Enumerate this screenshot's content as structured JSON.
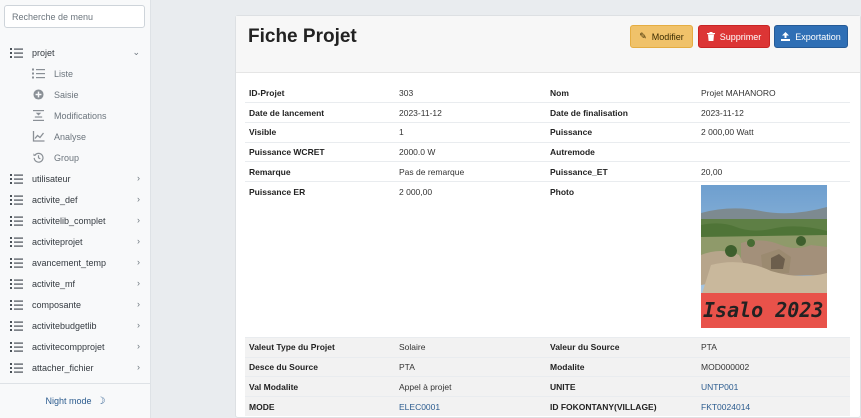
{
  "search": {
    "placeholder": "Recherche de menu"
  },
  "sidebar": {
    "open_item": {
      "label": "projet",
      "chevron": "chevron-down-icon"
    },
    "sub_items": [
      {
        "label": "Liste",
        "icon": "list-icon"
      },
      {
        "label": "Saisie",
        "icon": "plus-circle-icon"
      },
      {
        "label": "Modifications",
        "icon": "compress-icon"
      },
      {
        "label": "Analyse",
        "icon": "chart-line-icon"
      },
      {
        "label": "Group",
        "icon": "history-icon"
      }
    ],
    "items": [
      {
        "label": "utilisateur"
      },
      {
        "label": "activite_def"
      },
      {
        "label": "activitelib_complet"
      },
      {
        "label": "activiteprojet"
      },
      {
        "label": "avancement_temp"
      },
      {
        "label": "activite_mf"
      },
      {
        "label": "composante"
      },
      {
        "label": "activitebudgetlib"
      },
      {
        "label": "activitecompprojet"
      },
      {
        "label": "attacher_fichier"
      }
    ],
    "night_mode": "Night mode"
  },
  "main": {
    "title": "Fiche Projet",
    "buttons": {
      "edit": "Modifier",
      "delete": "Supprimer",
      "export": "Exportation"
    },
    "photo_caption": "Isalo 2023",
    "rows": [
      {
        "k1": "ID-Projet",
        "v1": "303",
        "k2": "Nom",
        "v2": "Projet MAHANORO"
      },
      {
        "k1": "Date de lancement",
        "v1": "2023-11-12",
        "k2": "Date de finalisation",
        "v2": "2023-11-12"
      },
      {
        "k1": "Visible",
        "v1": "1",
        "k2": "Puissance",
        "v2": "2 000,00 Watt"
      },
      {
        "k1": "Puissance WCRET",
        "v1": "2000.0 W",
        "k2": "Autremode",
        "v2": ""
      },
      {
        "k1": "Remarque",
        "v1": "Pas de remarque",
        "k2": "Puissance_ET",
        "v2": "20,00"
      },
      {
        "k1": "Puissance ER",
        "v1": "2 000,00",
        "k2": "Photo",
        "v2": ""
      },
      {
        "k1": "Valeut Type du Projet",
        "v1": "Solaire",
        "k2": "Valeur du Source",
        "v2": "PTA"
      },
      {
        "k1": "Desce du Source",
        "v1": "PTA",
        "k2": "Modalite",
        "v2": "MOD000002"
      },
      {
        "k1": "Val Modalite",
        "v1": "Appel à projet",
        "k2": "UNITE",
        "v2": "UNTP001"
      },
      {
        "k1": "MODE",
        "v1": "ELEC0001",
        "k2": "ID FOKONTANY(VILLAGE)",
        "v2": "FKT0024014"
      }
    ]
  },
  "colors": {
    "accent": "#2c5c8f",
    "warning": "#f0c26a",
    "danger": "#dc3535",
    "primary": "#2f6fb5"
  }
}
